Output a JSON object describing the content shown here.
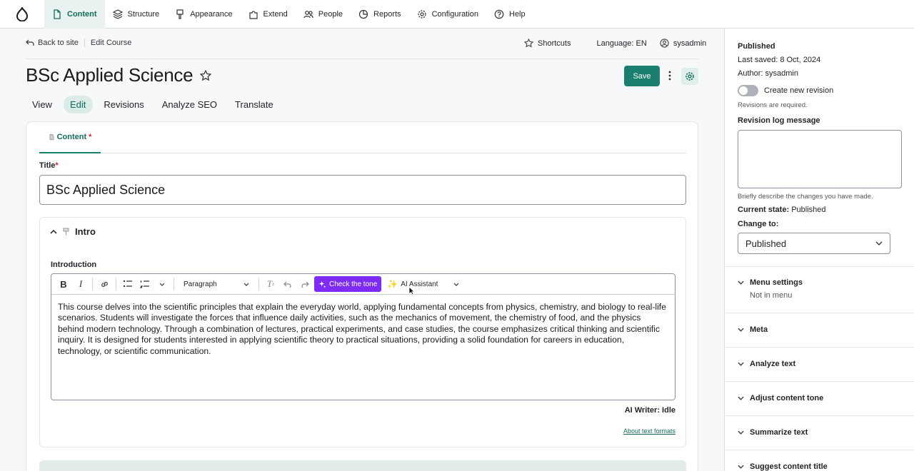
{
  "toolbar": {
    "items": [
      {
        "label": "Content",
        "icon": "document-icon"
      },
      {
        "label": "Structure",
        "icon": "layers-icon"
      },
      {
        "label": "Appearance",
        "icon": "brush-icon"
      },
      {
        "label": "Extend",
        "icon": "puzzle-icon"
      },
      {
        "label": "People",
        "icon": "people-icon"
      },
      {
        "label": "Reports",
        "icon": "chart-icon"
      },
      {
        "label": "Configuration",
        "icon": "gear-icon"
      },
      {
        "label": "Help",
        "icon": "help-icon"
      }
    ],
    "active": "Content"
  },
  "header": {
    "back_label": "Back to site",
    "breadcrumb": "Edit Course",
    "shortcuts_label": "Shortcuts",
    "language": "Language: EN",
    "user": "sysadmin",
    "title": "BSc Applied Science",
    "save_label": "Save"
  },
  "local_tabs": [
    "View",
    "Edit",
    "Revisions",
    "Analyze SEO",
    "Translate"
  ],
  "form": {
    "content_tab": "Content",
    "required_mark": "*",
    "title_label": "Title",
    "title_value": "BSc Applied Science",
    "intro_summary": "Intro",
    "introduction_label": "Introduction",
    "format_select": "Paragraph",
    "tone_button": "Check the tone",
    "ai_button": "AI Assistant",
    "body_text": "This course delves into the scientific principles that explain the everyday world, applying fundamental concepts from physics, chemistry, and biology to real-life scenarios. Students will investigate the forces that influence daily activities, such as the mechanics of movement, the chemistry of food, and the physics behind modern technology. Through a combination of lectures, practical experiments, and case studies, the course emphasizes critical thinking and scientific inquiry. It is designed for students interested in applying scientific theory to practical situations, providing a solid foundation for careers in education, technology, or scientific communication.",
    "ai_status": "AI Writer: Idle",
    "formats_link": "About text formats"
  },
  "sidebar": {
    "status": "Published",
    "last_saved": "Last saved: 8 Oct, 2024",
    "author": "Author: sysadmin",
    "revision_toggle": "Create new revision",
    "revision_hint": "Revisions are required.",
    "log_label": "Revision log message",
    "log_hint": "Briefly describe the changes you have made.",
    "current_state_label": "Current state:",
    "current_state_value": "Published",
    "change_to_label": "Change to:",
    "change_to_value": "Published",
    "sections": [
      {
        "title": "Menu settings",
        "sub": "Not in menu"
      },
      {
        "title": "Meta"
      },
      {
        "title": "Analyze text"
      },
      {
        "title": "Adjust content tone"
      },
      {
        "title": "Summarize text"
      },
      {
        "title": "Suggest content title"
      }
    ]
  },
  "colors": {
    "accent": "#1a7f6e",
    "tone_button": "#7e2cf5"
  }
}
